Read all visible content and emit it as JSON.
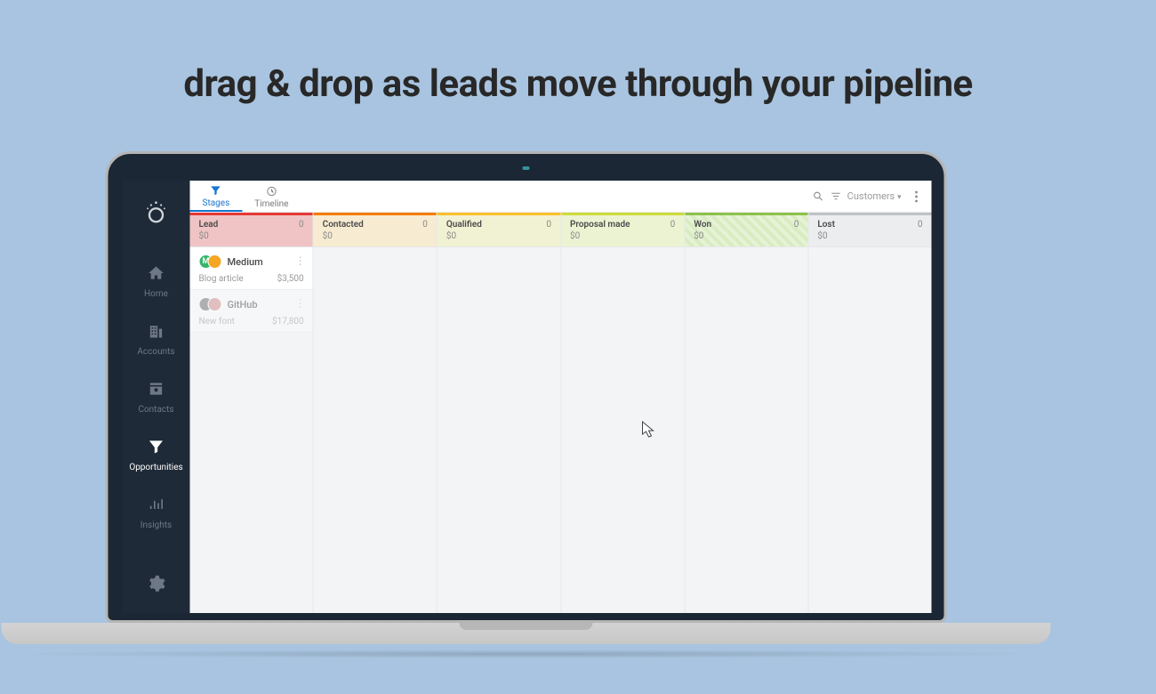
{
  "hero": "drag & drop as leads move through your pipeline",
  "sidebar": {
    "items": [
      {
        "label": "Home"
      },
      {
        "label": "Accounts"
      },
      {
        "label": "Contacts"
      },
      {
        "label": "Opportunities"
      },
      {
        "label": "Insights"
      }
    ]
  },
  "tabs": {
    "stages": "Stages",
    "timeline": "Timeline"
  },
  "topright": {
    "filter_name": "Customers"
  },
  "stages": [
    {
      "name": "Lead",
      "count": "0",
      "amount": "$0"
    },
    {
      "name": "Contacted",
      "count": "0",
      "amount": "$0"
    },
    {
      "name": "Qualified",
      "count": "0",
      "amount": "$0"
    },
    {
      "name": "Proposal made",
      "count": "0",
      "amount": "$0"
    },
    {
      "name": "Won",
      "count": "0",
      "amount": "$0"
    },
    {
      "name": "Lost",
      "count": "0",
      "amount": "$0"
    }
  ],
  "cards": [
    {
      "account": "Medium",
      "desc": "Blog article",
      "amount": "$3,500"
    },
    {
      "account": "GitHub",
      "desc": "New font",
      "amount": "$17,800"
    }
  ]
}
